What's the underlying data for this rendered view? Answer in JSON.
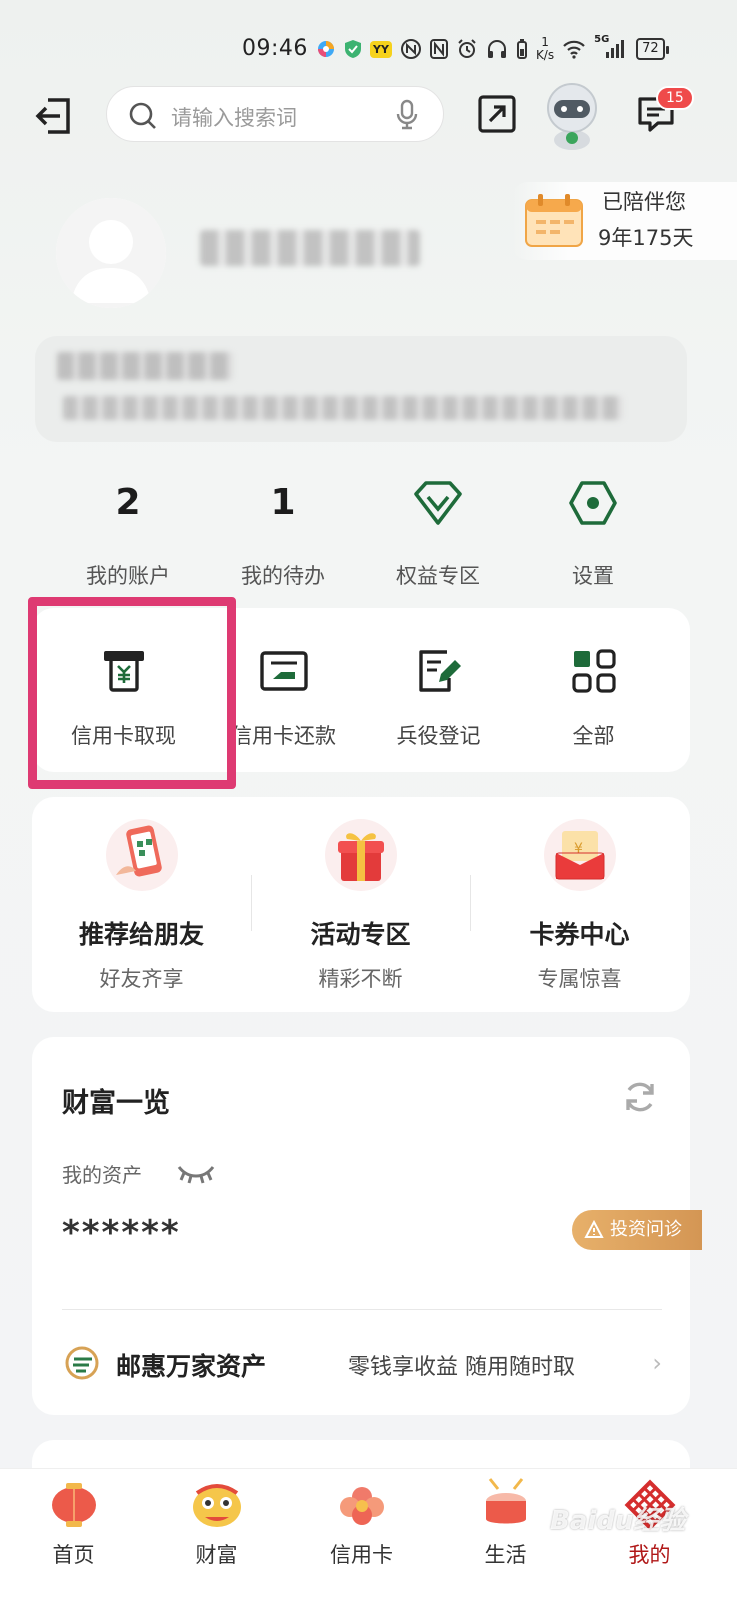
{
  "status_bar": {
    "time": "09:46",
    "speed_top": "1",
    "speed_unit": "K/s",
    "network": "5G",
    "battery": "72",
    "yy_label": "YY"
  },
  "header": {
    "search_placeholder": "请输入搜索词",
    "message_badge": "15"
  },
  "profile": {
    "companion_line1": "已陪伴您",
    "companion_line2": "9年175天"
  },
  "stats": [
    {
      "value": "2",
      "label": "我的账户"
    },
    {
      "value": "1",
      "label": "我的待办"
    },
    {
      "label": "权益专区",
      "icon": "diamond-icon"
    },
    {
      "label": "设置",
      "icon": "settings-hex-icon"
    }
  ],
  "quick_actions": [
    {
      "label": "信用卡取现",
      "icon": "atm-cash-icon"
    },
    {
      "label": "信用卡还款",
      "icon": "card-repay-icon"
    },
    {
      "label": "兵役登记",
      "icon": "edit-doc-icon"
    },
    {
      "label": "全部",
      "icon": "grid-icon"
    }
  ],
  "promos": [
    {
      "title": "推荐给朋友",
      "subtitle": "好友齐享"
    },
    {
      "title": "活动专区",
      "subtitle": "精彩不断"
    },
    {
      "title": "卡券中心",
      "subtitle": "专属惊喜"
    }
  ],
  "wealth": {
    "title": "财富一览",
    "assets_label": "我的资产",
    "assets_value": "******",
    "invest_button": "投资问诊"
  },
  "youhui": {
    "title": "邮惠万家资产",
    "description": "零钱享收益 随用随时取"
  },
  "bottom_nav": [
    {
      "label": "首页",
      "active": false
    },
    {
      "label": "财富",
      "active": false
    },
    {
      "label": "信用卡",
      "active": false
    },
    {
      "label": "生活",
      "active": false
    },
    {
      "label": "我的",
      "active": true
    }
  ],
  "watermark": "Baidu经验",
  "colors": {
    "brand_green": "#1e6b3a",
    "highlight_pink": "#de3a72",
    "badge_red": "#ef4a4a",
    "invest_gold": "#d49654"
  }
}
